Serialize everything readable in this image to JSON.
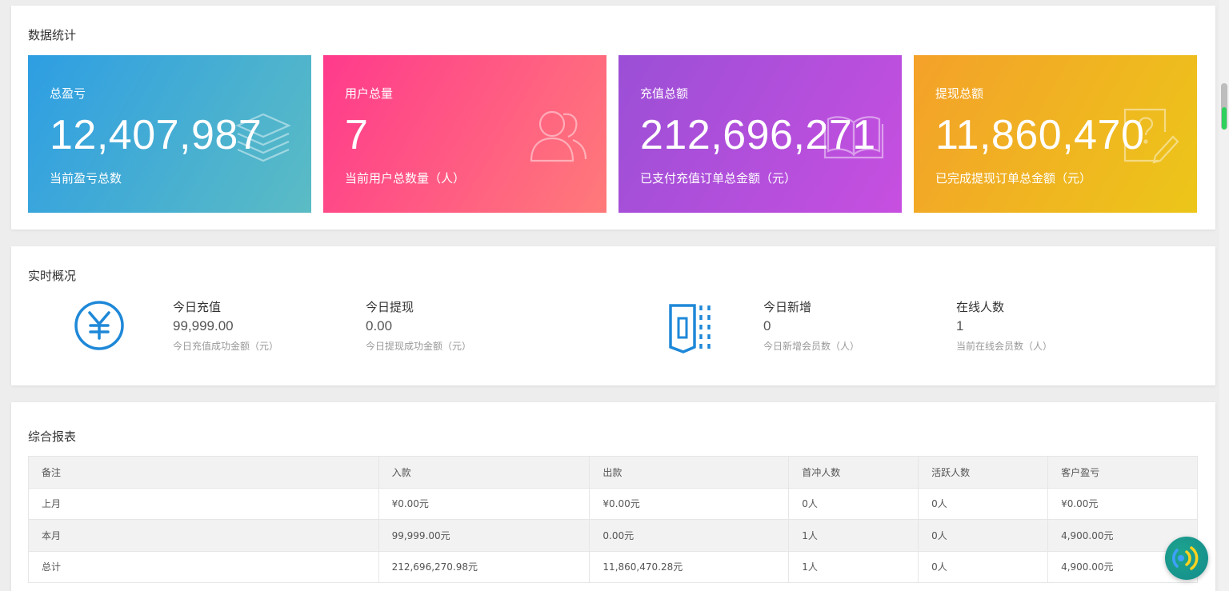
{
  "stats": {
    "title": "数据统计",
    "cards": [
      {
        "label": "总盈亏",
        "value": "12,407,987",
        "desc": "当前盈亏总数",
        "icon": "layers-icon"
      },
      {
        "label": "用户总量",
        "value": "7",
        "desc": "当前用户总数量（人）",
        "icon": "users-icon"
      },
      {
        "label": "充值总额",
        "value": "212,696,271",
        "desc": "已支付充值订单总金额（元）",
        "icon": "book-icon"
      },
      {
        "label": "提现总额",
        "value": "11,860,470",
        "desc": "已完成提现订单总金额（元）",
        "icon": "edit-note-icon"
      }
    ]
  },
  "realtime": {
    "title": "实时概况",
    "items": [
      {
        "label": "今日充值",
        "value": "99,999.00",
        "desc": "今日充值成功金额（元）"
      },
      {
        "label": "今日提现",
        "value": "0.00",
        "desc": "今日提现成功金额（元）"
      },
      {
        "label": "今日新增",
        "value": "0",
        "desc": "今日新增会员数（人）"
      },
      {
        "label": "在线人数",
        "value": "1",
        "desc": "当前在线会员数（人）"
      }
    ],
    "icons": [
      "yen-icon",
      "door-icon"
    ],
    "accent": "#1e88d8"
  },
  "report": {
    "title": "综合报表",
    "columns": [
      "备注",
      "入款",
      "出款",
      "首冲人数",
      "活跃人数",
      "客户盈亏"
    ],
    "rows": [
      [
        "上月",
        "¥0.00元",
        "¥0.00元",
        "0人",
        "0人",
        "¥0.00元"
      ],
      [
        "本月",
        "99,999.00元",
        "0.00元",
        "1人",
        "0人",
        "4,900.00元"
      ],
      [
        "总计",
        "212,696,270.98元",
        "11,860,470.28元",
        "1人",
        "0人",
        "4,900.00元"
      ]
    ]
  },
  "float_button": {
    "icon": "sound-icon"
  }
}
